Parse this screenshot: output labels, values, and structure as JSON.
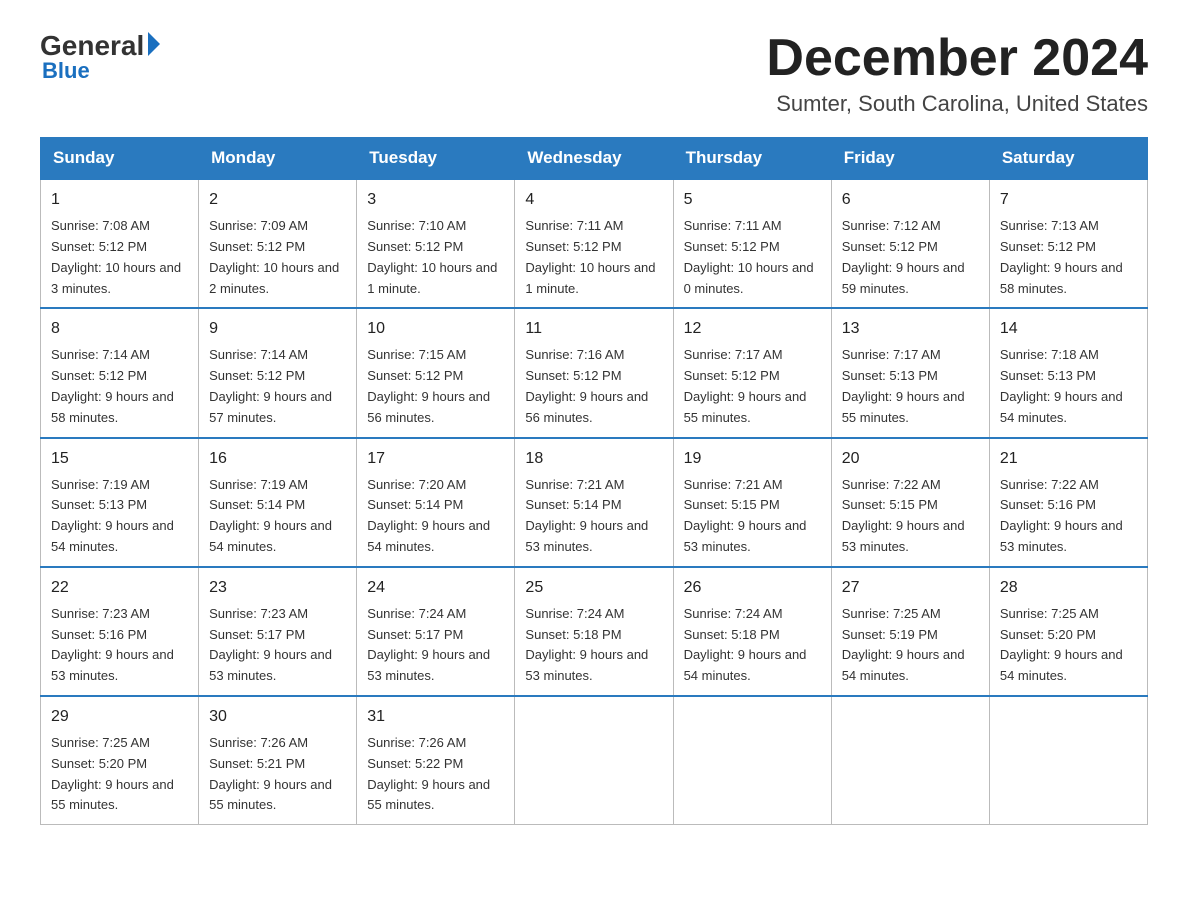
{
  "header": {
    "logo": {
      "general": "General",
      "triangle": "",
      "blue": "Blue"
    },
    "title": "December 2024",
    "location": "Sumter, South Carolina, United States"
  },
  "days_of_week": [
    "Sunday",
    "Monday",
    "Tuesday",
    "Wednesday",
    "Thursday",
    "Friday",
    "Saturday"
  ],
  "weeks": [
    [
      {
        "day": "1",
        "sunrise": "7:08 AM",
        "sunset": "5:12 PM",
        "daylight": "10 hours and 3 minutes."
      },
      {
        "day": "2",
        "sunrise": "7:09 AM",
        "sunset": "5:12 PM",
        "daylight": "10 hours and 2 minutes."
      },
      {
        "day": "3",
        "sunrise": "7:10 AM",
        "sunset": "5:12 PM",
        "daylight": "10 hours and 1 minute."
      },
      {
        "day": "4",
        "sunrise": "7:11 AM",
        "sunset": "5:12 PM",
        "daylight": "10 hours and 1 minute."
      },
      {
        "day": "5",
        "sunrise": "7:11 AM",
        "sunset": "5:12 PM",
        "daylight": "10 hours and 0 minutes."
      },
      {
        "day": "6",
        "sunrise": "7:12 AM",
        "sunset": "5:12 PM",
        "daylight": "9 hours and 59 minutes."
      },
      {
        "day": "7",
        "sunrise": "7:13 AM",
        "sunset": "5:12 PM",
        "daylight": "9 hours and 58 minutes."
      }
    ],
    [
      {
        "day": "8",
        "sunrise": "7:14 AM",
        "sunset": "5:12 PM",
        "daylight": "9 hours and 58 minutes."
      },
      {
        "day": "9",
        "sunrise": "7:14 AM",
        "sunset": "5:12 PM",
        "daylight": "9 hours and 57 minutes."
      },
      {
        "day": "10",
        "sunrise": "7:15 AM",
        "sunset": "5:12 PM",
        "daylight": "9 hours and 56 minutes."
      },
      {
        "day": "11",
        "sunrise": "7:16 AM",
        "sunset": "5:12 PM",
        "daylight": "9 hours and 56 minutes."
      },
      {
        "day": "12",
        "sunrise": "7:17 AM",
        "sunset": "5:12 PM",
        "daylight": "9 hours and 55 minutes."
      },
      {
        "day": "13",
        "sunrise": "7:17 AM",
        "sunset": "5:13 PM",
        "daylight": "9 hours and 55 minutes."
      },
      {
        "day": "14",
        "sunrise": "7:18 AM",
        "sunset": "5:13 PM",
        "daylight": "9 hours and 54 minutes."
      }
    ],
    [
      {
        "day": "15",
        "sunrise": "7:19 AM",
        "sunset": "5:13 PM",
        "daylight": "9 hours and 54 minutes."
      },
      {
        "day": "16",
        "sunrise": "7:19 AM",
        "sunset": "5:14 PM",
        "daylight": "9 hours and 54 minutes."
      },
      {
        "day": "17",
        "sunrise": "7:20 AM",
        "sunset": "5:14 PM",
        "daylight": "9 hours and 54 minutes."
      },
      {
        "day": "18",
        "sunrise": "7:21 AM",
        "sunset": "5:14 PM",
        "daylight": "9 hours and 53 minutes."
      },
      {
        "day": "19",
        "sunrise": "7:21 AM",
        "sunset": "5:15 PM",
        "daylight": "9 hours and 53 minutes."
      },
      {
        "day": "20",
        "sunrise": "7:22 AM",
        "sunset": "5:15 PM",
        "daylight": "9 hours and 53 minutes."
      },
      {
        "day": "21",
        "sunrise": "7:22 AM",
        "sunset": "5:16 PM",
        "daylight": "9 hours and 53 minutes."
      }
    ],
    [
      {
        "day": "22",
        "sunrise": "7:23 AM",
        "sunset": "5:16 PM",
        "daylight": "9 hours and 53 minutes."
      },
      {
        "day": "23",
        "sunrise": "7:23 AM",
        "sunset": "5:17 PM",
        "daylight": "9 hours and 53 minutes."
      },
      {
        "day": "24",
        "sunrise": "7:24 AM",
        "sunset": "5:17 PM",
        "daylight": "9 hours and 53 minutes."
      },
      {
        "day": "25",
        "sunrise": "7:24 AM",
        "sunset": "5:18 PM",
        "daylight": "9 hours and 53 minutes."
      },
      {
        "day": "26",
        "sunrise": "7:24 AM",
        "sunset": "5:18 PM",
        "daylight": "9 hours and 54 minutes."
      },
      {
        "day": "27",
        "sunrise": "7:25 AM",
        "sunset": "5:19 PM",
        "daylight": "9 hours and 54 minutes."
      },
      {
        "day": "28",
        "sunrise": "7:25 AM",
        "sunset": "5:20 PM",
        "daylight": "9 hours and 54 minutes."
      }
    ],
    [
      {
        "day": "29",
        "sunrise": "7:25 AM",
        "sunset": "5:20 PM",
        "daylight": "9 hours and 55 minutes."
      },
      {
        "day": "30",
        "sunrise": "7:26 AM",
        "sunset": "5:21 PM",
        "daylight": "9 hours and 55 minutes."
      },
      {
        "day": "31",
        "sunrise": "7:26 AM",
        "sunset": "5:22 PM",
        "daylight": "9 hours and 55 minutes."
      },
      null,
      null,
      null,
      null
    ]
  ],
  "labels": {
    "sunrise": "Sunrise:",
    "sunset": "Sunset:",
    "daylight": "Daylight:"
  }
}
